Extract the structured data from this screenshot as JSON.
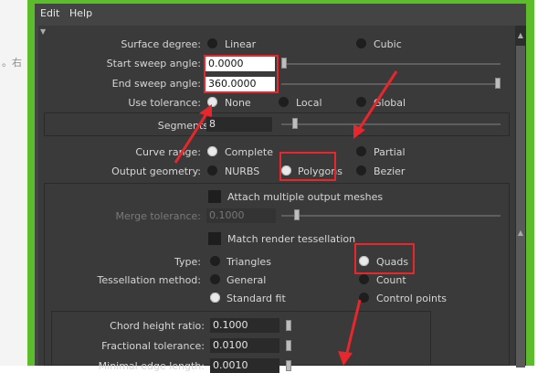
{
  "menu": {
    "edit": "Edit",
    "help": "Help"
  },
  "bg_text": "。右",
  "surface_degree": {
    "label": "Surface degree:",
    "options": [
      "Linear",
      "Cubic"
    ],
    "selected": "Linear"
  },
  "start_sweep": {
    "label": "Start sweep angle:",
    "value": "0.0000"
  },
  "end_sweep": {
    "label": "End sweep angle:",
    "value": "360.0000"
  },
  "use_tolerance": {
    "label": "Use tolerance:",
    "options": [
      "None",
      "Local",
      "Global"
    ],
    "selected": "None"
  },
  "segments": {
    "label": "Segments",
    "value": "8"
  },
  "curve_range": {
    "label": "Curve range:",
    "options": [
      "Complete",
      "Partial"
    ],
    "selected": "Complete"
  },
  "output_geometry": {
    "label": "Output geometry:",
    "options": [
      "NURBS",
      "Polygons",
      "Bezier"
    ],
    "selected": "Polygons"
  },
  "attach_meshes": {
    "label": "Attach multiple output meshes",
    "checked": false
  },
  "merge_tolerance": {
    "label": "Merge tolerance:",
    "value": "0.1000"
  },
  "match_render": {
    "label": "Match render tessellation",
    "checked": false
  },
  "type": {
    "label": "Type:",
    "options": [
      "Triangles",
      "Quads"
    ],
    "selected": "Quads"
  },
  "tess_method": {
    "label": "Tessellation method:",
    "options": [
      "General",
      "Count",
      "Standard fit",
      "Control points"
    ],
    "selected": "Standard fit"
  },
  "chord_height": {
    "label": "Chord height ratio:",
    "value": "0.1000"
  },
  "fractional_tol": {
    "label": "Fractional tolerance:",
    "value": "0.0100"
  },
  "minimal_edge": {
    "label": "Minimal edge length:",
    "value": "0.0010"
  },
  "colors": {
    "frame": "#5cbc2c",
    "panel": "#3a3a3a",
    "highlight": "#e8262b"
  }
}
